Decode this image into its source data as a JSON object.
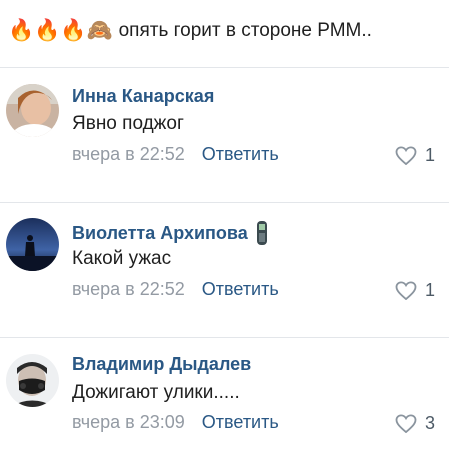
{
  "post": {
    "emojis": "🔥🔥🔥🙈",
    "text": "опять горит в стороне РММ.."
  },
  "comments": [
    {
      "author": "Инна Канарская",
      "text": "Явно поджог",
      "time": "вчера в 22:52",
      "reply_label": "Ответить",
      "likes": "1",
      "avatar_icon": "user-photo-woman",
      "badge_icon": ""
    },
    {
      "author": "Виолетта Архипова",
      "text": "Какой ужас",
      "time": "вчера в 22:52",
      "reply_label": "Ответить",
      "likes": "1",
      "avatar_icon": "user-photo-silhouette",
      "badge_icon": "mobile-phone-icon"
    },
    {
      "author": "Владимир Дыдалев",
      "text": "Дожигают улики.....",
      "time": "вчера в 23:09",
      "reply_label": "Ответить",
      "likes": "3",
      "avatar_icon": "user-photo-mask",
      "badge_icon": ""
    }
  ],
  "colors": {
    "author": "#2a5885",
    "meta": "#939aa3",
    "divider": "#e3e6ea"
  }
}
